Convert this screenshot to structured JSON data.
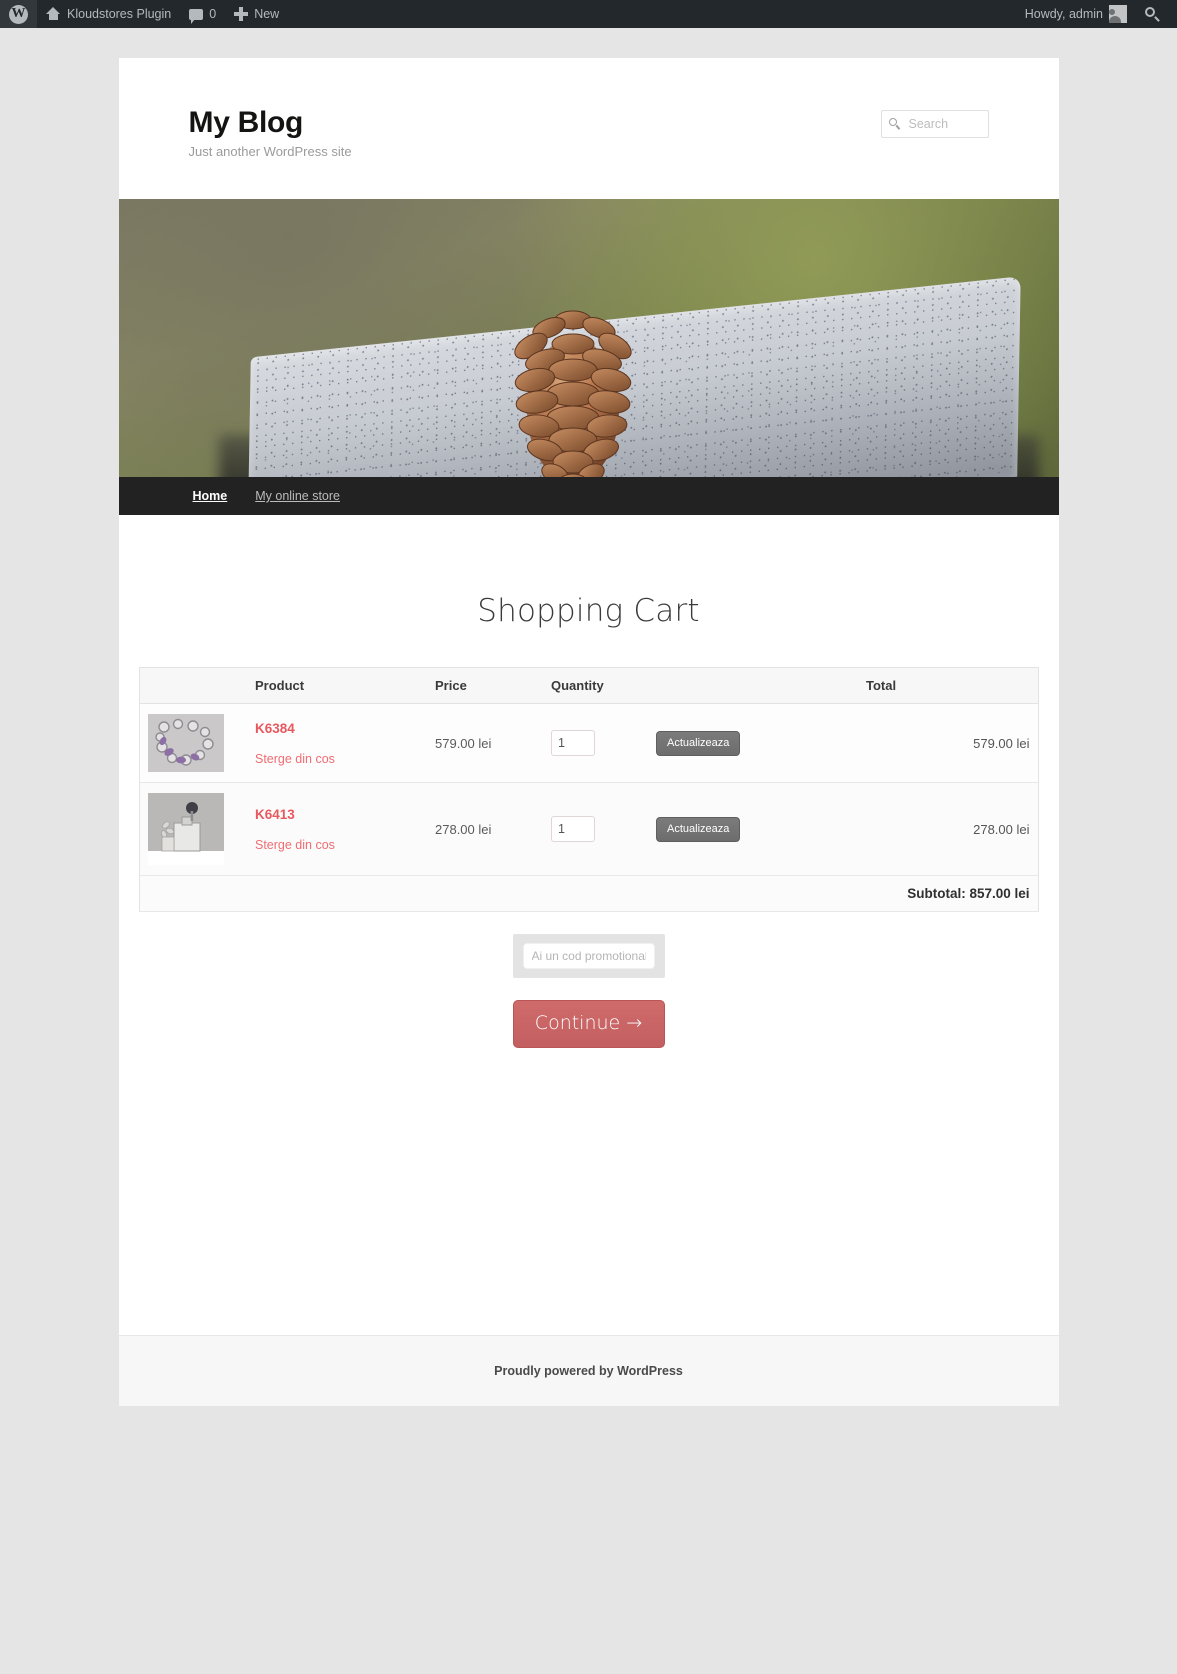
{
  "adminbar": {
    "logo_icon": "wordpress-logo-icon",
    "home_icon": "home-icon",
    "site_name": "Kloudstores Plugin",
    "comments_icon": "comment-bubble-icon",
    "comments_count": "0",
    "new_icon": "plus-icon",
    "new_label": "New",
    "howdy": "Howdy, admin",
    "avatar_icon": "avatar-icon",
    "search_icon": "search-icon"
  },
  "site": {
    "title": "My Blog",
    "description": "Just another WordPress site",
    "search_placeholder": "Search",
    "search_value": "",
    "search_icon": "search-icon",
    "hero_image_alt": "pinecone-on-granite-block"
  },
  "nav": {
    "items": [
      {
        "label": "Home",
        "active": true
      },
      {
        "label": "My online store",
        "active": false
      }
    ]
  },
  "cart": {
    "heading": "Shopping Cart",
    "columns": {
      "thumb": "",
      "product": "Product",
      "price": "Price",
      "quantity": "Quantity",
      "update": "",
      "total": "Total"
    },
    "rows": [
      {
        "thumb_alt": "bracelet-product-thumbnail",
        "name": "K6384",
        "remove_label": "Sterge din cos",
        "price": "579.00 lei",
        "quantity": "1",
        "update_label": "Actualizeaza",
        "total": "579.00 lei"
      },
      {
        "thumb_alt": "earrings-product-thumbnail",
        "name": "K6413",
        "remove_label": "Sterge din cos",
        "price": "278.00 lei",
        "quantity": "1",
        "update_label": "Actualizeaza",
        "total": "278.00 lei"
      }
    ],
    "subtotal": "Subtotal: 857.00 lei",
    "promo_placeholder": "Ai un cod promotional?",
    "promo_value": "",
    "continue_label": "Continue →"
  },
  "footer": {
    "credit": "Proudly powered by WordPress"
  },
  "colors": {
    "adminbar_bg": "#23282d",
    "accent_red": "#e8585f",
    "continue_btn": "#c86a6a",
    "nav_bg": "#222222"
  }
}
